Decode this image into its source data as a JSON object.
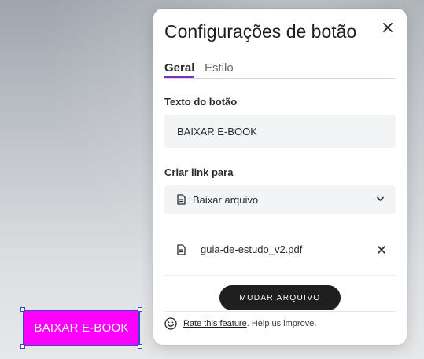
{
  "canvas": {
    "button_text": "BAIXAR E-BOOK",
    "button_color": "#ff00ff",
    "selection_color": "#3a47c8"
  },
  "panel": {
    "title": "Configurações de botão",
    "close_icon": "close-icon",
    "tabs": [
      {
        "label": "Geral",
        "active": true
      },
      {
        "label": "Estilo",
        "active": false
      }
    ],
    "accent": "#7b2fbf",
    "button_text_label": "Texto do botão",
    "button_text_value": "BAIXAR E-BOOK",
    "link_label": "Criar link para",
    "link_select": {
      "icon": "document-icon",
      "value": "Baixar arquivo"
    },
    "file": {
      "icon": "document-icon",
      "name": "guia-de-estudo_v2.pdf"
    },
    "change_file_button": "MUDAR ARQUIVO",
    "feedback": {
      "icon": "smile-icon",
      "link": "Rate this feature",
      "text": ". Help us improve."
    }
  }
}
